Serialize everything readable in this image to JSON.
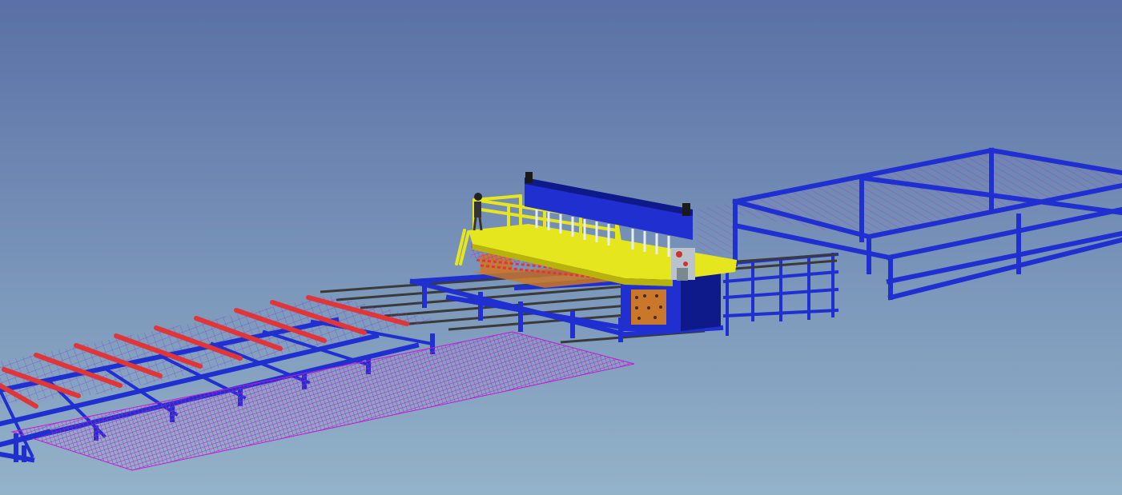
{
  "scene": {
    "subject": "mesh-welding-production-line",
    "colors": {
      "sky_top": "#5a70a6",
      "sky_bottom": "#93b3c9",
      "frame_blue": "#1f2fd0",
      "frame_blue_dark": "#0f1a8a",
      "mesh_magenta": "#c21ad6",
      "mesh_purple": "#7a3fd8",
      "rail_red": "#e0363a",
      "rail_orange": "#e8642a",
      "machine_yellow": "#e6e61e",
      "machine_yellow_dark": "#b8b20c",
      "cabinet_orange": "#c9772a",
      "rail_gray": "#3a3a3a"
    }
  }
}
